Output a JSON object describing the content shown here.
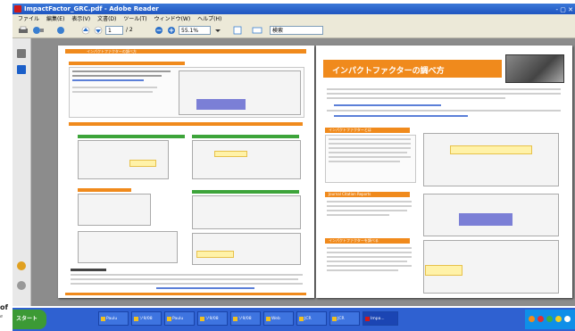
{
  "window": {
    "title": "ImpactFactor_GRC.pdf - Adobe Reader",
    "controls": "- ▢ ✕"
  },
  "menu": [
    "ファイル",
    "編集(E)",
    "表示(V)",
    "文書(D)",
    "ツール(T)",
    "ウィンドウ(W)",
    "ヘルプ(H)"
  ],
  "toolbar": {
    "page_current": "1",
    "page_total": "/ 2",
    "zoom": "55.1%",
    "search_value": "検索"
  },
  "document": {
    "left_page": {
      "header": "インパクトファクターの調べ方"
    },
    "right_page": {
      "title": "インパクトファクターの調べ方",
      "section1": "インパクトファクターとは",
      "section2": "Journal Citation Reports",
      "section3": "インパクトファクターを調べる"
    }
  },
  "taskbar": {
    "start_label": "スタート",
    "tasks": [
      "Paulu",
      "ソ9/08",
      "Paulu",
      "ソ9/08",
      "ソ9/08",
      "Web",
      "JCR",
      "JCR",
      "Impa..."
    ]
  },
  "caption": {
    "line1": "of",
    "line2": "e"
  },
  "colors": {
    "accent_orange": "#f08a1c",
    "accent_green": "#3da43a",
    "taskbar_blue": "#2f61d1"
  }
}
